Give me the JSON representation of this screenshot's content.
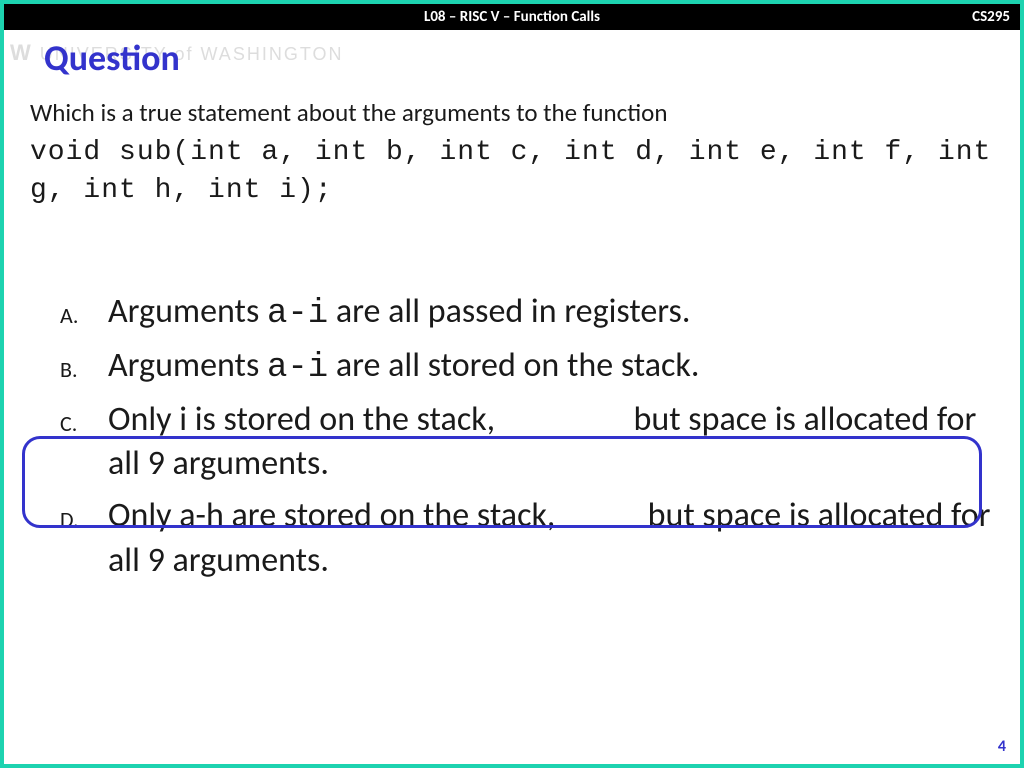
{
  "header": {
    "title": "L08 – RISC V – Function Calls",
    "course": "CS295"
  },
  "watermark": "UNIVERSITY of WASHINGTON",
  "slide": {
    "title": "Question",
    "question_intro": "Which is a true statement about the arguments to the function",
    "code_signature": "void sub(int a, int b, int c, int d, int e, int f, int g, int h, int i);",
    "options": {
      "a": {
        "letter": "A.",
        "pre": "Arguments ",
        "code": "a-i",
        "post": " are all passed in registers."
      },
      "b": {
        "letter": "B.",
        "pre": "Arguments ",
        "code": "a-i",
        "post": " are all stored on the stack."
      },
      "c": {
        "letter": "C.",
        "text": "Only i is stored on the stack,                  but space is allocated for all 9 arguments."
      },
      "d": {
        "letter": "D.",
        "text": "Only a-h are stored on the stack,            but space is allocated for all 9 arguments."
      }
    },
    "page_number": "4"
  }
}
